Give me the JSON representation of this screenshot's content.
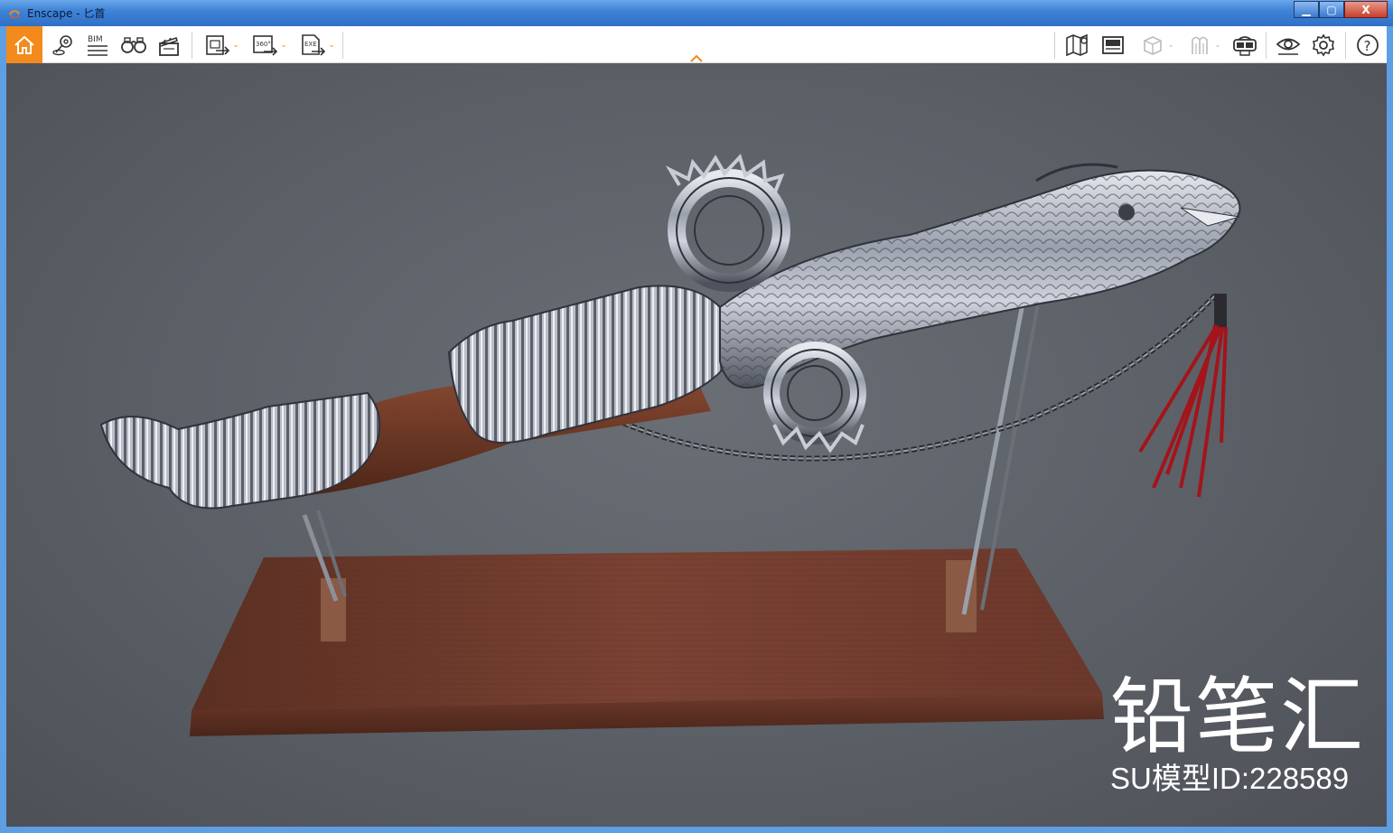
{
  "window": {
    "title": "Enscape - 匕首",
    "controls": {
      "minimize": "▁",
      "maximize": "▢",
      "close": "X"
    }
  },
  "toolbar": {
    "accent_color": "#f38a1c",
    "left_tools": [
      {
        "icon": "home-icon",
        "label": ""
      },
      {
        "icon": "location-pin-icon",
        "label": ""
      },
      {
        "icon": "bim-icon",
        "label": "BIM"
      },
      {
        "icon": "binoculars-icon",
        "label": ""
      },
      {
        "icon": "clapperboard-icon",
        "label": ""
      },
      {
        "icon": "export-image-icon",
        "label": ""
      },
      {
        "icon": "export-360-icon",
        "label": "360°"
      },
      {
        "icon": "export-exe-icon",
        "label": "EXE"
      }
    ],
    "right_tools": [
      {
        "icon": "map-icon"
      },
      {
        "icon": "asset-library-icon"
      },
      {
        "icon": "cube-icon"
      },
      {
        "icon": "walk-icon"
      },
      {
        "icon": "vr-headset-icon"
      },
      {
        "icon": "eye-icon"
      },
      {
        "icon": "settings-gear-icon"
      },
      {
        "icon": "help-icon",
        "label": "?"
      }
    ],
    "center_toggle_icon": "chevron-up-icon"
  },
  "viewport": {
    "watermark_main": "铅笔汇",
    "watermark_sub": "SU模型ID:228589"
  }
}
